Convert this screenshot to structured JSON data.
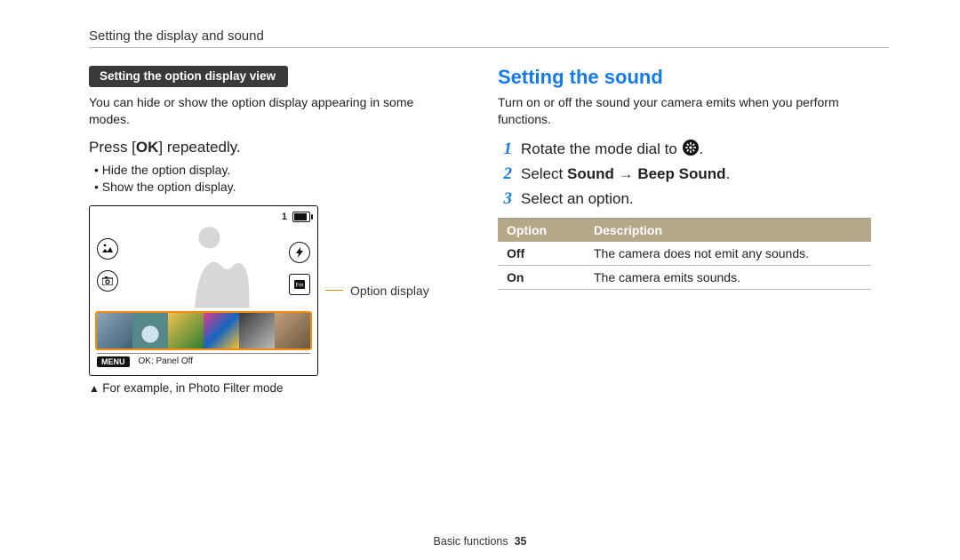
{
  "page": {
    "breadcrumb": "Setting the display and sound",
    "section_name": "Basic functions",
    "page_number": "35"
  },
  "left": {
    "pill": "Setting the option display view",
    "intro": "You can hide or show the option display appearing in some modes.",
    "press_prefix": "Press [",
    "press_glyph": "OK",
    "press_suffix": "] repeatedly.",
    "bullets": [
      "Hide the option display.",
      "Show the option display."
    ],
    "screen": {
      "hud_counter": "1",
      "menu_label": "MENU",
      "ok_label": "OK: Panel Off"
    },
    "callout": "Option display",
    "caption": "For example, in Photo Filter mode"
  },
  "right": {
    "heading": "Setting the sound",
    "intro": "Turn on or off the sound your camera emits when you perform functions.",
    "steps": [
      {
        "n": "1",
        "before": "Rotate the mode dial to ",
        "after": "."
      },
      {
        "n": "2",
        "before": "Select ",
        "b1": "Sound",
        "arrow": " → ",
        "b2": "Beep Sound",
        "after": "."
      },
      {
        "n": "3",
        "before": "Select an option."
      }
    ],
    "table": {
      "h_option": "Option",
      "h_desc": "Description",
      "rows": [
        {
          "opt": "Off",
          "desc": "The camera does not emit any sounds."
        },
        {
          "opt": "On",
          "desc": "The camera emits sounds."
        }
      ]
    }
  }
}
